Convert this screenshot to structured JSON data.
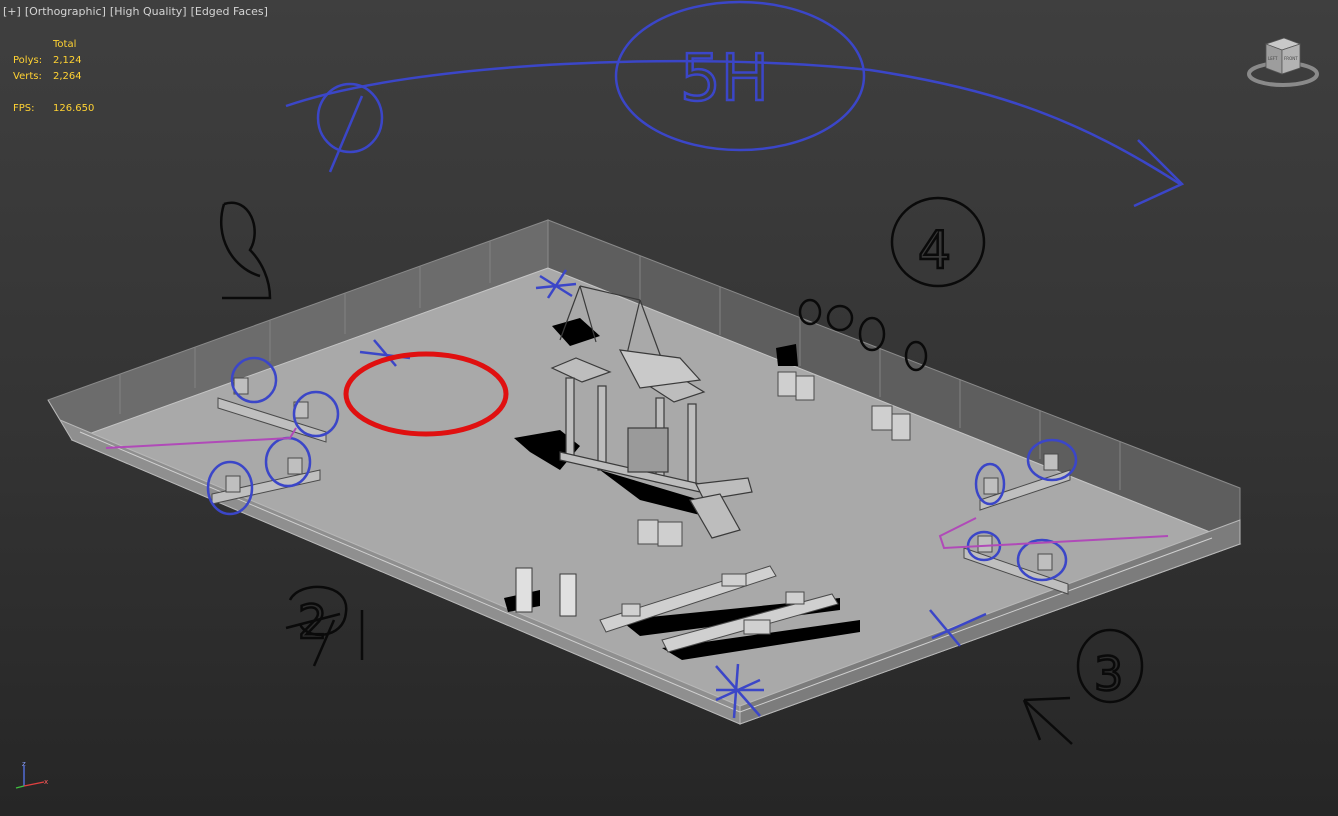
{
  "viewport": {
    "label_items": [
      "[+]",
      "[Orthographic]",
      "[High Quality]",
      "[Edged Faces]"
    ]
  },
  "stats": {
    "header": "Total",
    "polys_label": "Polys:",
    "polys_value": "2,124",
    "verts_label": "Verts:",
    "verts_value": "2,264",
    "fps_label": "FPS:",
    "fps_value": "126.650"
  },
  "viewcube": {
    "face_left": "LEFT",
    "face_front": "FRONT"
  },
  "axis_gizmo": {
    "x": "x",
    "z": "z"
  },
  "annotations": {
    "blue_note": "5H",
    "zone_numbers": [
      "1",
      "2",
      "3",
      "4"
    ],
    "colors": {
      "blue_ink": "#3b46c8",
      "black_ink": "#0a0a0a",
      "red_ink": "#e01010",
      "magenta_path": "#b04ab8"
    }
  },
  "colors": {
    "background_top": "#3f3f3f",
    "background_bottom": "#262626",
    "floor": "#a8a8a8",
    "stats_text": "#ffd233"
  }
}
